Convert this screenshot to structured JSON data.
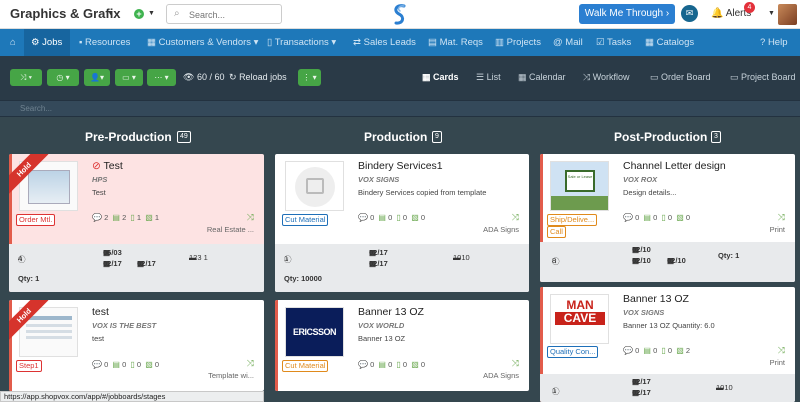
{
  "app": {
    "company": "Graphics & Grafix",
    "search_placeholder": "Search...",
    "walk_button": "Walk Me Through",
    "alerts_label": "Alerts",
    "alerts_count": "4"
  },
  "nav": [
    "Jobs",
    "Resources",
    "Customers & Vendors",
    "Transactions",
    "Sales Leads",
    "Mat. Reqs",
    "Projects",
    "Mail",
    "Tasks",
    "Catalogs",
    "Help"
  ],
  "toolbar": {
    "count": "60 / 60",
    "reload": "Reload jobs"
  },
  "views": [
    "Cards",
    "List",
    "Calendar",
    "Workflow",
    "Order Board",
    "Project Board"
  ],
  "board_search_placeholder": "Search...",
  "columns": [
    {
      "title": "Pre-Production",
      "count": "49"
    },
    {
      "title": "Production",
      "count": "9"
    },
    {
      "title": "Post-Production",
      "count": "3"
    }
  ],
  "cards": {
    "c1": {
      "hold": "Hold",
      "title": "Test",
      "subtitle": "HPS",
      "desc": "Test",
      "tag": "Order Mtl.",
      "msgs": "2",
      "files": "2",
      "docs": "1",
      "imgs": "1",
      "right": "Real Estate ...",
      "info": "4",
      "date1": "06/03",
      "date2": "02/17",
      "date3": "02/17",
      "ship": "123 1",
      "qty": "Qty: 1"
    },
    "c2": {
      "hold": "Hold",
      "title": "test",
      "subtitle": "VOX IS THE BEST",
      "desc": "test",
      "tag": "Step1",
      "msgs": "0",
      "files": "0",
      "docs": "0",
      "imgs": "0",
      "right": "Template wi..."
    },
    "c3": {
      "title": "Bindery Services1",
      "subtitle": "VOX SIGNS",
      "desc": "Bindery Services copied from template",
      "tag": "Cut Material",
      "msgs": "0",
      "files": "0",
      "docs": "0",
      "imgs": "0",
      "right": "ADA Signs",
      "info": "1",
      "date1": "02/17",
      "date2": "02/17",
      "ship": "1010",
      "qty": "Qty: 10000"
    },
    "c4": {
      "title": "Banner 13 OZ",
      "subtitle": "VOX WORLD",
      "desc": "Banner 13 OZ",
      "tag": "Cut Material",
      "msgs": "0",
      "files": "0",
      "docs": "0",
      "imgs": "0",
      "right": "ADA Signs",
      "logo_text": "ERICSSON"
    },
    "c5": {
      "title": "Channel Letter design",
      "subtitle": "VOX ROX",
      "desc": "Design details...",
      "tag": "Ship/Delive...",
      "tag2": "Call",
      "msgs": "0",
      "files": "0",
      "docs": "0",
      "imgs": "0",
      "right": "Print",
      "info": "8",
      "date1": "02/10",
      "date2": "02/10",
      "date3": "02/10",
      "qty": "Qty: 1",
      "sign_text": "Sale or Lease"
    },
    "c6": {
      "title": "Banner 13 OZ",
      "subtitle": "VOX SIGNS",
      "desc": "Banner 13 OZ Quantity: 6.0",
      "tag": "Quality Con...",
      "msgs": "0",
      "files": "0",
      "docs": "0",
      "imgs": "2",
      "right": "Print",
      "info": "1",
      "date1": "02/17",
      "date2": "02/17",
      "ship": "1010",
      "logo_line1": "MAN",
      "logo_line2": "CAVE"
    }
  },
  "status_url": "https://app.shopvox.com/app/#/jobboards/stages"
}
